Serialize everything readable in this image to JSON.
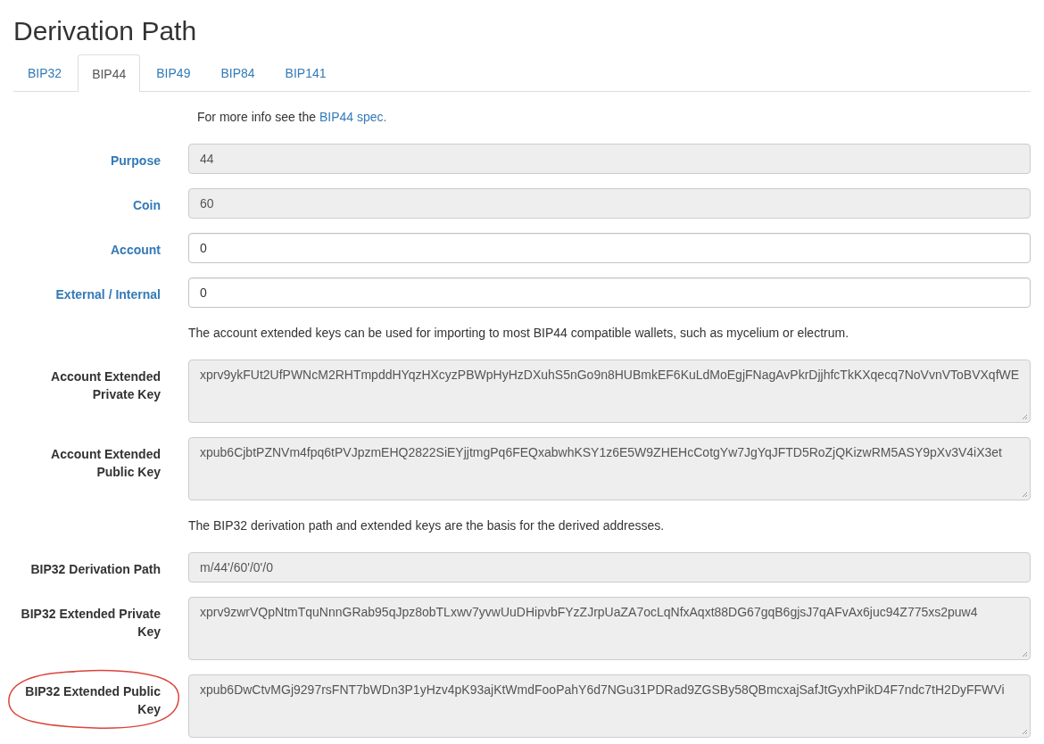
{
  "title": "Derivation Path",
  "tabs": [
    {
      "label": "BIP32",
      "selected": false
    },
    {
      "label": "BIP44",
      "selected": true
    },
    {
      "label": "BIP49",
      "selected": false
    },
    {
      "label": "BIP84",
      "selected": false
    },
    {
      "label": "BIP141",
      "selected": false
    }
  ],
  "rows": [
    {
      "kind": "note",
      "text": "For more info see the ",
      "link": "BIP44 spec."
    },
    {
      "kind": "field",
      "label": "Purpose",
      "label_link": true,
      "value": "44",
      "readonly": true,
      "circled": false
    },
    {
      "kind": "field",
      "label": "Coin",
      "label_link": true,
      "value": "60",
      "readonly": true,
      "circled": false
    },
    {
      "kind": "field",
      "label": "Account",
      "label_link": true,
      "value": "0",
      "readonly": false,
      "circled": false
    },
    {
      "kind": "field",
      "label": "External / Internal",
      "label_link": true,
      "value": "0",
      "readonly": false,
      "circled": false
    },
    {
      "kind": "note",
      "text": "The account extended keys can be used for importing to most BIP44 compatible wallets, such as mycelium or electrum."
    },
    {
      "kind": "textarea",
      "label": "Account Extended Private Key",
      "label_link": false,
      "value": "xprv9ykFUt2UfPWNcM2RHTmpddHYqzHXcyzPBWpHyHzDXuhS5nGo9n8HUBmkEF6KuLdMoEgjFNagAvPkrDjjhfcTkKXqecq7NoVvnVToBVXqfWE",
      "readonly": true,
      "circled": false
    },
    {
      "kind": "textarea",
      "label": "Account Extended Public Key",
      "label_link": false,
      "value": "xpub6CjbtPZNVm4fpq6tPVJpzmEHQ2822SiEYjjtmgPq6FEQxabwhKSY1z6E5W9ZHEHcCotgYw7JgYqJFTD5RoZjQKizwRM5ASY9pXv3V4iX3et",
      "readonly": true,
      "circled": false
    },
    {
      "kind": "note",
      "text": "The BIP32 derivation path and extended keys are the basis for the derived addresses."
    },
    {
      "kind": "field",
      "label": "BIP32 Derivation Path",
      "label_link": false,
      "value": "m/44'/60'/0'/0",
      "readonly": true,
      "circled": false
    },
    {
      "kind": "textarea",
      "label": "BIP32 Extended Private Key",
      "label_link": false,
      "value": "xprv9zwrVQpNtmTquNnnGRab95qJpz8obTLxwv7yvwUuDHipvbFYzZJrpUaZA7ocLqNfxAqxt88DG67gqB6gjsJ7qAFvAx6juc94Z775xs2puw4",
      "readonly": true,
      "circled": false
    },
    {
      "kind": "textarea",
      "label": "BIP32 Extended Public Key",
      "label_link": false,
      "value": "xpub6DwCtvMGj9297rsFNT7bWDn3P1yHzv4pK93ajKtWmdFooPahY6d7NGu31PDRad9ZGSBy58QBmcxajSafJtGyxhPikD4F7ndc7tH2DyFFWVi",
      "readonly": true,
      "circled": true
    }
  ]
}
